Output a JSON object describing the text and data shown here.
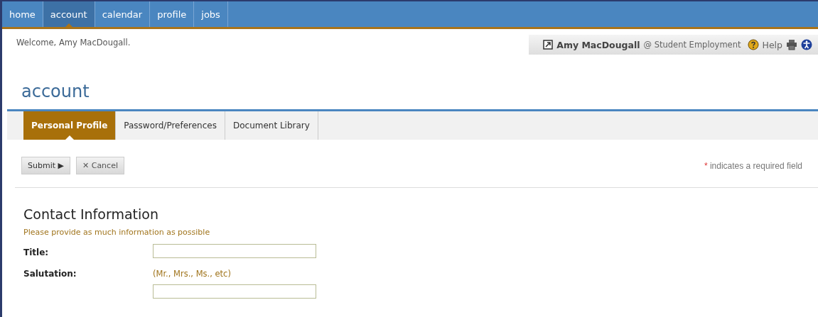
{
  "nav": [
    {
      "label": "home",
      "selected": false
    },
    {
      "label": "account",
      "selected": true
    },
    {
      "label": "calendar",
      "selected": false
    },
    {
      "label": "profile",
      "selected": false
    },
    {
      "label": "jobs",
      "selected": false
    }
  ],
  "welcome": "Welcome, Amy MacDougall.",
  "user_box": {
    "name": "Amy MacDougall",
    "org": "@ Student Employment",
    "help": "Help"
  },
  "page_title": "account",
  "tabs": [
    {
      "label": "Personal Profile",
      "selected": true
    },
    {
      "label": "Password/Preferences",
      "selected": false
    },
    {
      "label": "Document Library",
      "selected": false
    }
  ],
  "buttons": [
    {
      "kind": "submit",
      "label": "Submit",
      "icon": "▶"
    },
    {
      "kind": "cancel",
      "label": "Cancel",
      "icon": "✕"
    }
  ],
  "required_note": {
    "mark": "*",
    "text": "indicates a required field"
  },
  "section": {
    "title": "Contact Information",
    "subtitle": "Please provide as much information as possible"
  },
  "fields": [
    {
      "label": "Title:"
    },
    {
      "label": "Salutation:",
      "hint": "(Mr., Mrs., Ms., etc)"
    }
  ]
}
